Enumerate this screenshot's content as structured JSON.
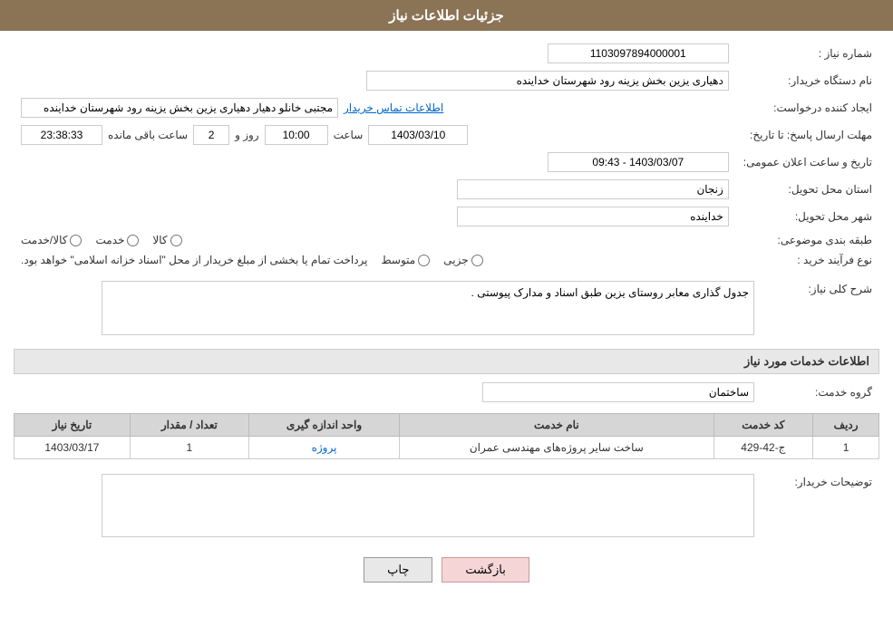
{
  "header": {
    "title": "جزئیات اطلاعات نیاز"
  },
  "fields": {
    "need_number_label": "شماره نیاز :",
    "need_number_value": "1103097894000001",
    "buyer_org_label": "نام دستگاه خریدار:",
    "buyer_org_value": "دهیاری یزین بخش یزینه رود شهرستان خداینده",
    "creator_label": "ایجاد کننده درخواست:",
    "creator_value": "مجتبی خانلو دهیار دهیاری یزین بخش یزینه رود شهرستان خداینده",
    "contact_link": "اطلاعات تماس خریدار",
    "deadline_label": "مهلت ارسال پاسخ: تا تاریخ:",
    "deadline_date": "1403/03/10",
    "deadline_time_label": "ساعت",
    "deadline_time": "10:00",
    "deadline_days_label": "روز و",
    "deadline_days": "2",
    "deadline_remaining_label": "ساعت باقی مانده",
    "deadline_remaining": "23:38:33",
    "announcement_label": "تاریخ و ساعت اعلان عمومی:",
    "announcement_value": "1403/03/07 - 09:43",
    "province_label": "استان محل تحویل:",
    "province_value": "زنجان",
    "city_label": "شهر محل تحویل:",
    "city_value": "خداینده",
    "category_label": "طبقه بندی موضوعی:",
    "category_options": [
      {
        "label": "کالا",
        "value": "kala",
        "checked": false
      },
      {
        "label": "خدمت",
        "value": "khedmat",
        "checked": false
      },
      {
        "label": "کالا/خدمت",
        "value": "kala_khedmat",
        "checked": false
      }
    ],
    "purchase_type_label": "نوع فرآیند خرید :",
    "purchase_type_options": [
      {
        "label": "جزیی",
        "value": "jozi",
        "checked": false
      },
      {
        "label": "متوسط",
        "value": "motovaset",
        "checked": false
      }
    ],
    "purchase_note": "پرداخت تمام یا بخشی از مبلغ خریدار از محل \"اسناد خزانه اسلامی\" خواهد بود.",
    "need_description_label": "شرح کلی نیاز:",
    "need_description_value": "جدول گذاری معابر روستای یزین طبق اسناد و مدارک پیوستی .",
    "services_label": "اطلاعات خدمات مورد نیاز",
    "service_group_label": "گروه خدمت:",
    "service_group_value": "ساختمان",
    "table": {
      "columns": [
        "ردیف",
        "کد خدمت",
        "نام خدمت",
        "واحد اندازه گیری",
        "تعداد / مقدار",
        "تاریخ نیاز"
      ],
      "rows": [
        {
          "row_num": "1",
          "service_code": "ج-42-429",
          "service_name": "ساخت سایر پروژه‌های مهندسی عمران",
          "unit": "پروژه",
          "quantity": "1",
          "date": "1403/03/17"
        }
      ]
    },
    "buyer_desc_label": "توضیحات خریدار:",
    "buyer_desc_value": ""
  },
  "buttons": {
    "print_label": "چاپ",
    "back_label": "بازگشت"
  }
}
